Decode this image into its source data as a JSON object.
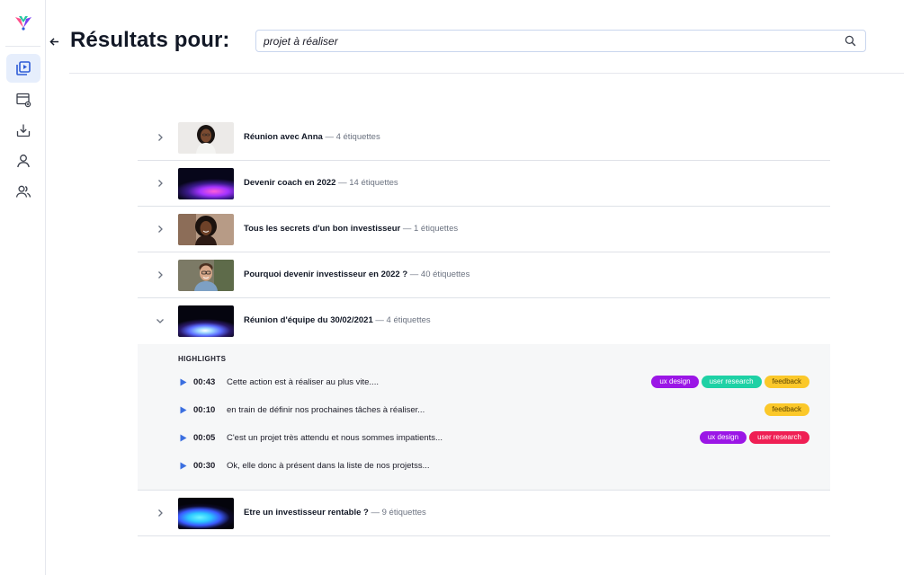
{
  "page": {
    "title": "Résultats pour:"
  },
  "search": {
    "value": "projet à réaliser"
  },
  "colors": {
    "accent": "#2d5bd6",
    "active_nav_bg": "#e6eefc",
    "tag_ux_design": "#9b16e6",
    "tag_user_research_teal": "#1ed1a5",
    "tag_feedback": "#fbc82a",
    "tag_user_research_red": "#ef1f54"
  },
  "sidebar": {
    "items": [
      {
        "icon": "video-library-icon",
        "active": true
      },
      {
        "icon": "screen-share-icon",
        "active": false
      },
      {
        "icon": "download-icon",
        "active": false
      },
      {
        "icon": "user-icon",
        "active": false
      },
      {
        "icon": "users-icon",
        "active": false
      }
    ]
  },
  "results": [
    {
      "title": "Réunion avec Anna",
      "count": "— 4 étiquettes",
      "thumb": "portrait-woman-curly"
    },
    {
      "title": "Devenir coach en 2022",
      "count": "— 14 étiquettes",
      "thumb": "gradient-purple"
    },
    {
      "title": "Tous les secrets d'un bon investisseur",
      "count": "— 1 étiquettes",
      "thumb": "portrait-woman-smiling"
    },
    {
      "title": "Pourquoi devenir investisseur en 2022 ?",
      "count": "— 40 étiquettes",
      "thumb": "portrait-man-glasses"
    },
    {
      "title": "Réunion d'équipe du 30/02/2021",
      "count": "— 4 étiquettes",
      "thumb": "gradient-blue",
      "expanded": true
    },
    {
      "title": "Etre un investisseur rentable ?",
      "count": "— 9 étiquettes",
      "thumb": "gradient-cyan"
    }
  ],
  "highlights": {
    "heading": "HIGHLIGHTS",
    "items": [
      {
        "time": "00:43",
        "text": "Cette action est à réaliser au plus vite....",
        "tags": [
          {
            "label": "ux design",
            "bg": "#9b16e6",
            "fg": "#ffffff"
          },
          {
            "label": "user research",
            "bg": "#1ed1a5",
            "fg": "#ffffff"
          },
          {
            "label": "feedback",
            "bg": "#fbc82a",
            "fg": "#5a4300"
          }
        ]
      },
      {
        "time": "00:10",
        "text": "en train de définir nos prochaines tâches à réaliser...",
        "tags": [
          {
            "label": "feedback",
            "bg": "#fbc82a",
            "fg": "#5a4300"
          }
        ]
      },
      {
        "time": "00:05",
        "text": "C'est un projet très attendu et nous sommes impatients...",
        "tags": [
          {
            "label": "ux design",
            "bg": "#9b16e6",
            "fg": "#ffffff"
          },
          {
            "label": "user research",
            "bg": "#ef1f54",
            "fg": "#ffffff"
          }
        ]
      },
      {
        "time": "00:30",
        "text": "Ok, elle donc à présent dans la liste de nos projetss...",
        "tags": []
      }
    ]
  }
}
